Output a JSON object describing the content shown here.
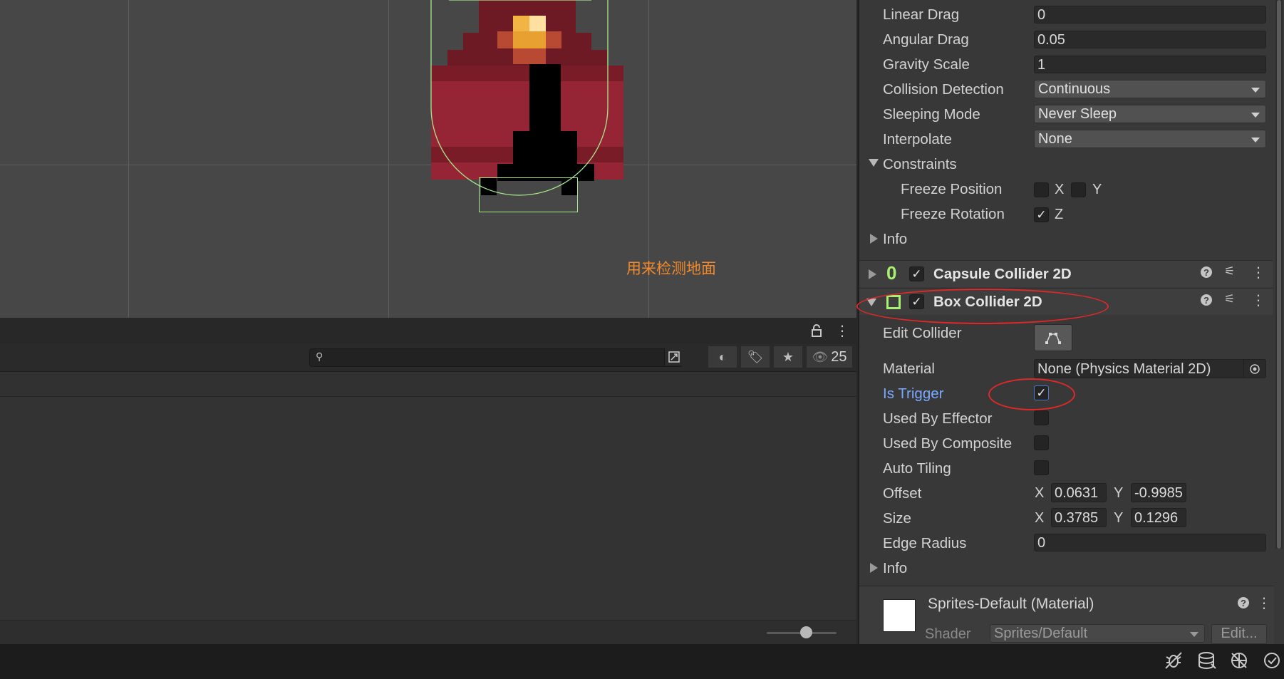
{
  "scene": {
    "annotation": "用来检测地面"
  },
  "toolbar": {
    "search_placeholder": "",
    "hidden_count": "25"
  },
  "inspector": {
    "rigidbody": {
      "rows": [
        {
          "label": "Linear Drag",
          "value": "0"
        },
        {
          "label": "Angular Drag",
          "value": "0.05"
        },
        {
          "label": "Gravity Scale",
          "value": "1"
        }
      ],
      "dropdowns": [
        {
          "label": "Collision Detection",
          "value": "Continuous"
        },
        {
          "label": "Sleeping Mode",
          "value": "Never Sleep"
        },
        {
          "label": "Interpolate",
          "value": "None"
        }
      ],
      "constraints_label": "Constraints",
      "freeze_position_label": "Freeze Position",
      "freeze_position_x": "X",
      "freeze_position_y": "Y",
      "freeze_rotation_label": "Freeze Rotation",
      "freeze_rotation_z": "Z",
      "info_label": "Info"
    },
    "capsule_collider": {
      "title": "Capsule Collider 2D",
      "icon": "0"
    },
    "box_collider": {
      "title": "Box Collider 2D",
      "edit_collider_label": "Edit Collider",
      "material_label": "Material",
      "material_value": "None (Physics Material 2D)",
      "is_trigger_label": "Is Trigger",
      "used_by_effector_label": "Used By Effector",
      "used_by_composite_label": "Used By Composite",
      "auto_tiling_label": "Auto Tiling",
      "offset_label": "Offset",
      "offset_x": "0.0631",
      "offset_y": "-0.9985",
      "size_label": "Size",
      "size_x": "0.3785",
      "size_y": "0.1296",
      "edge_radius_label": "Edge Radius",
      "edge_radius_value": "0",
      "info_label": "Info",
      "x_label": "X",
      "y_label": "Y"
    },
    "material": {
      "title": "Sprites-Default (Material)",
      "shader_label": "Shader",
      "shader_value": "Sprites/Default",
      "edit_button": "Edit..."
    }
  },
  "colors": {
    "accent_blue": "#7aa8ff",
    "annotation_orange": "#f08a2c",
    "collider_green": "#a8e88c",
    "red_marker": "#e02828"
  }
}
